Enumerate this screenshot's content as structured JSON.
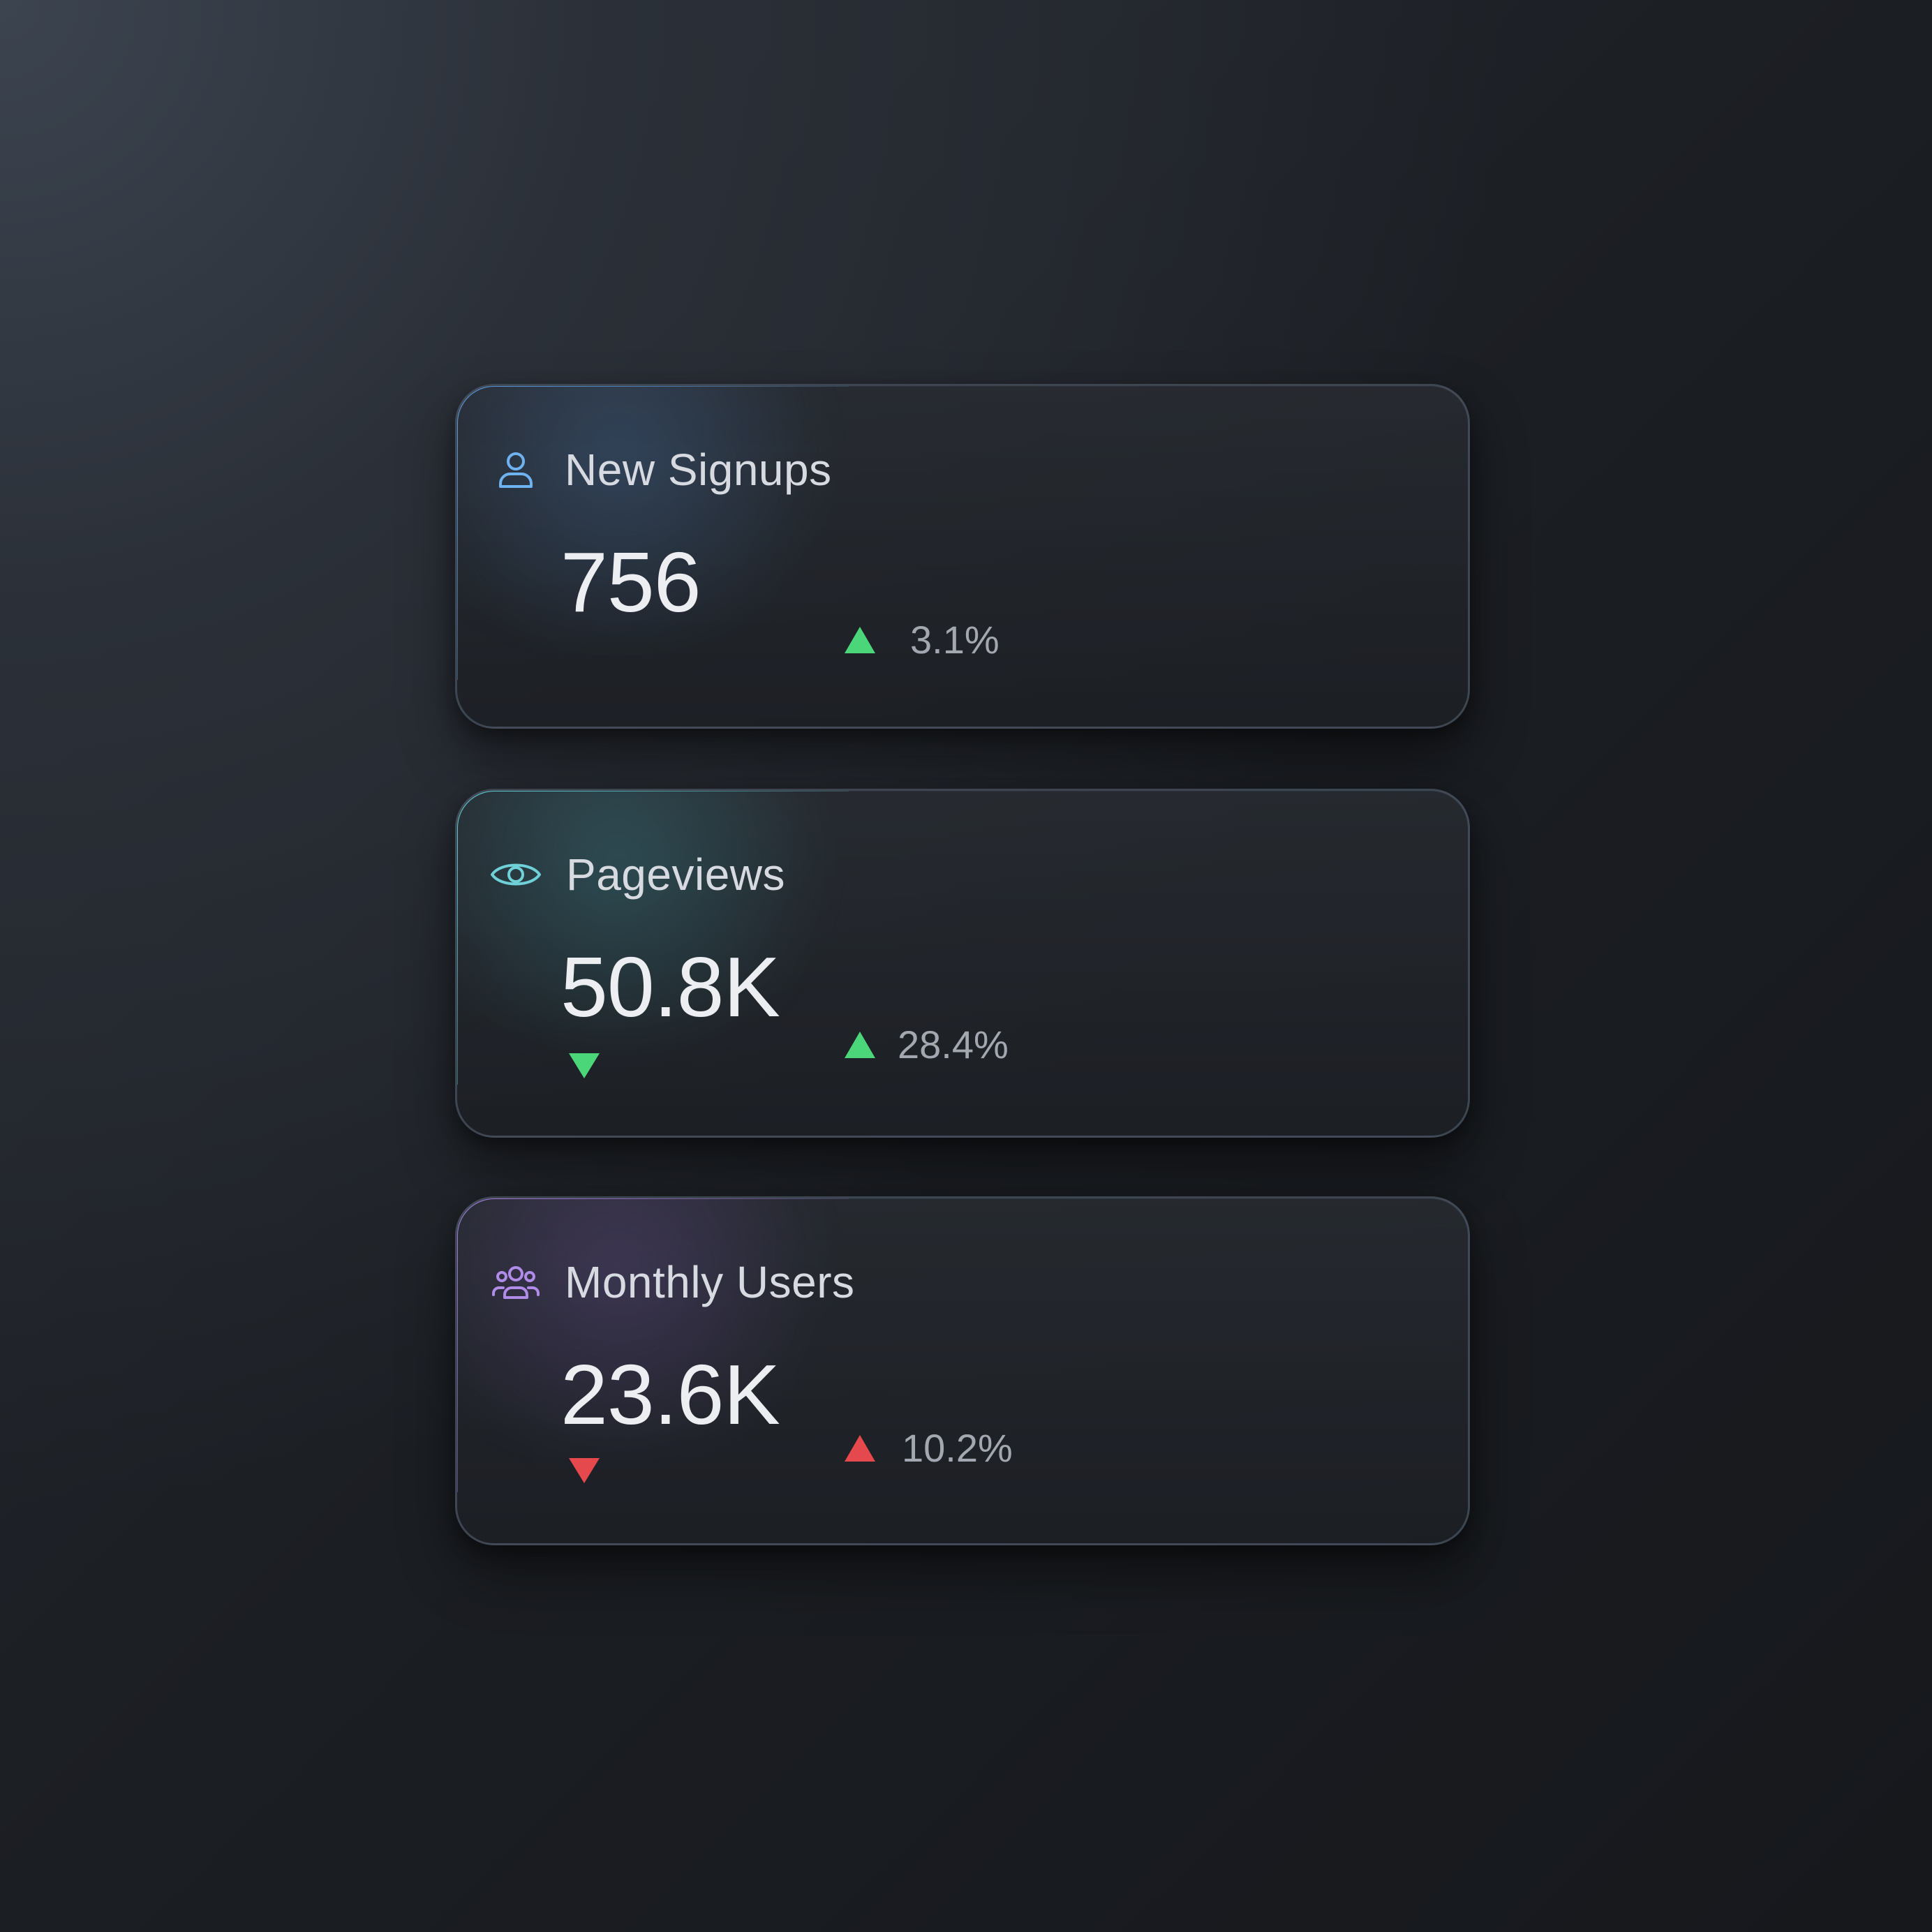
{
  "cards": [
    {
      "label": "New Signups",
      "icon": "user-icon",
      "value": "756",
      "delta": "3.1%",
      "delta_direction": "up",
      "delta_color": "#4cd67a",
      "accent": "#5aa0e8"
    },
    {
      "label": "Pageviews",
      "icon": "eye-icon",
      "value": "50.8K",
      "secondary_indicator": "down",
      "secondary_indicator_color": "#4cd67a",
      "delta": "28.4%",
      "delta_direction": "up",
      "delta_color": "#4cd67a",
      "accent": "#5fd3dc"
    },
    {
      "label": "Monthly Users",
      "icon": "users-group-icon",
      "value": "23.6K",
      "secondary_indicator": "down",
      "secondary_indicator_color": "#e5484d",
      "delta": "10.2%",
      "delta_direction": "up",
      "delta_color": "#e5484d",
      "accent": "#a77de8"
    }
  ]
}
